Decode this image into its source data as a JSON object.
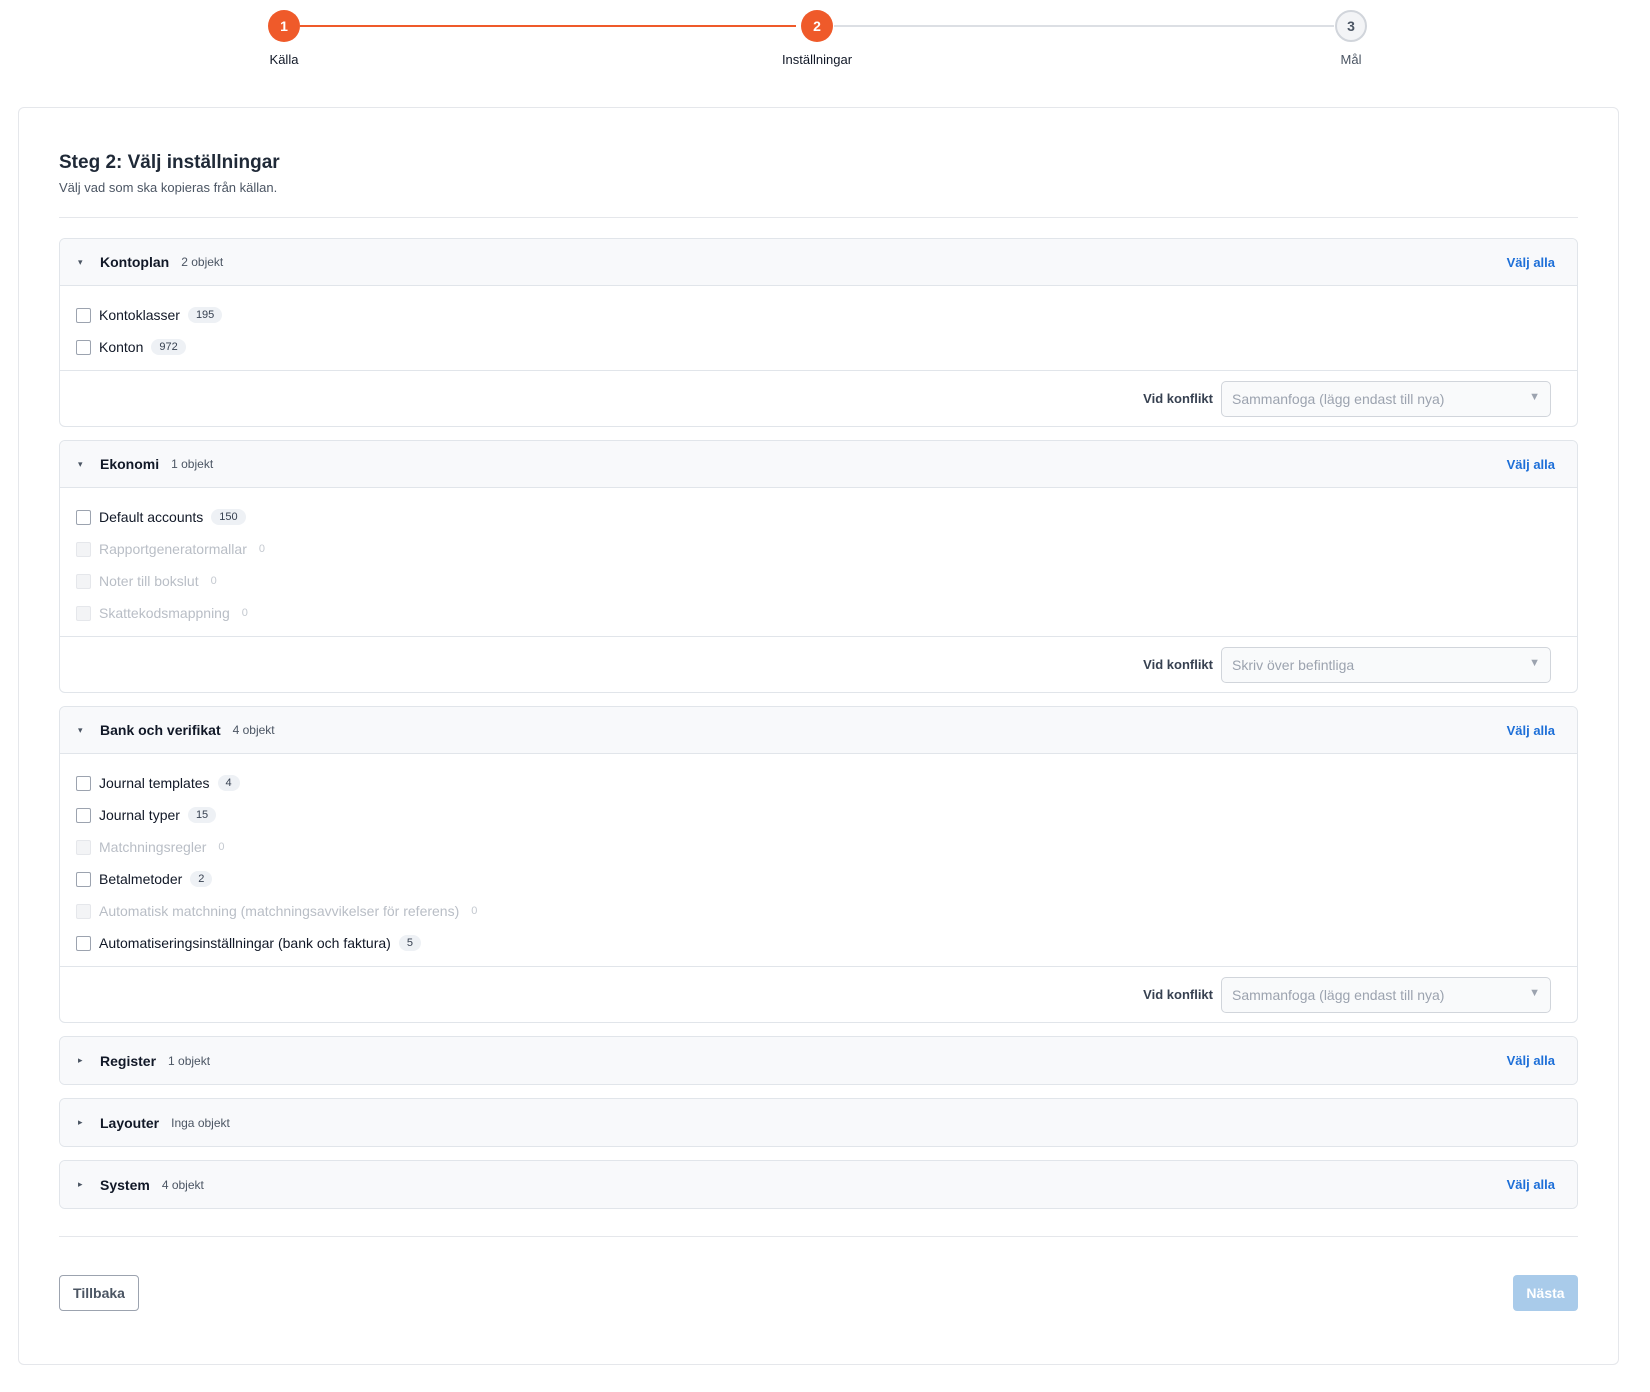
{
  "stepper": {
    "steps": [
      {
        "number": "1",
        "label": "Källa"
      },
      {
        "number": "2",
        "label": "Inställningar"
      },
      {
        "number": "3",
        "label": "Mål"
      }
    ],
    "current_step": 2
  },
  "header": {
    "title": "Steg 2: Välj inställningar",
    "subtitle": "Välj vad som ska kopieras från källan."
  },
  "select_all_label": "Välj alla",
  "conflict_label": "Vid konflikt",
  "sections": [
    {
      "name": "Kontoplan",
      "count": "2 objekt",
      "items": [
        {
          "label": "Kontoklasser",
          "count": "195"
        },
        {
          "label": "Konton",
          "count": "972"
        }
      ],
      "conflict_value": "Sammanfoga (lägg endast till nya)"
    },
    {
      "name": "Ekonomi",
      "count": "1 objekt",
      "items": [
        {
          "label": "Default accounts",
          "count": "150"
        },
        {
          "label": "Rapportgeneratormallar",
          "count": "0"
        },
        {
          "label": "Noter till bokslut",
          "count": "0"
        },
        {
          "label": "Skattekodsmappning",
          "count": "0"
        }
      ],
      "conflict_value": "Skriv över befintliga"
    },
    {
      "name": "Bank och verifikat",
      "count": "4 objekt",
      "items": [
        {
          "label": "Journal templates",
          "count": "4"
        },
        {
          "label": "Journal typer",
          "count": "15"
        },
        {
          "label": "Matchningsregler",
          "count": "0"
        },
        {
          "label": "Betalmetoder",
          "count": "2"
        },
        {
          "label": "Automatisk matchning (matchningsavvikelser för referens)",
          "count": "0"
        },
        {
          "label": "Automatiseringsinställningar (bank och faktura)",
          "count": "5"
        }
      ],
      "conflict_value": "Sammanfoga (lägg endast till nya)"
    },
    {
      "name": "Register",
      "count": "1 objekt"
    },
    {
      "name": "Layouter",
      "count": "Inga objekt"
    },
    {
      "name": "System",
      "count": "4 objekt"
    }
  ],
  "icons": {
    "expanded": "▾",
    "collapsed": "▸",
    "select_arrow": "▼"
  },
  "footer": {
    "back_label": "Tillbaka",
    "next_label": "Nästa"
  },
  "colors": {
    "accent": "#ef5a2a",
    "link": "#1d6fd8",
    "next_disabled": "#a9cbea"
  }
}
